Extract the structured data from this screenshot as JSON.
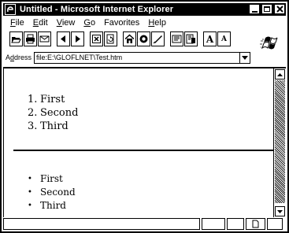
{
  "window": {
    "title": "Untitled - Microsoft Internet Explorer"
  },
  "menubar": {
    "items": [
      {
        "accel": "F",
        "rest": "ile"
      },
      {
        "accel": "E",
        "rest": "dit"
      },
      {
        "accel": "V",
        "rest": "iew"
      },
      {
        "accel": "G",
        "rest": "o"
      },
      {
        "accel": "",
        "rest": "Favorites"
      },
      {
        "accel": "H",
        "rest": "elp"
      }
    ]
  },
  "toolbar": {
    "groups": [
      [
        "open-icon",
        "print-icon",
        "send-icon"
      ],
      [
        "back-icon",
        "forward-icon"
      ],
      [
        "stop-icon",
        "refresh-icon"
      ],
      [
        "home-icon",
        "search-icon",
        "favorites-icon"
      ],
      [
        "read-mail-icon",
        "edit-icon"
      ],
      [
        "larger-font-icon",
        "smaller-font-icon"
      ]
    ],
    "font_larger_label": "A",
    "font_smaller_label": "A"
  },
  "address": {
    "label_accel": "d",
    "label_pre": "A",
    "label_post": "dress",
    "value": "file:E:\\GLOFLNET\\Test.htm"
  },
  "content": {
    "ordered_list": [
      {
        "marker": "1.",
        "text": "First"
      },
      {
        "marker": "2.",
        "text": "Second"
      },
      {
        "marker": "3.",
        "text": "Third"
      }
    ],
    "unordered_list": [
      {
        "marker": "•",
        "text": "First"
      },
      {
        "marker": "•",
        "text": "Second"
      },
      {
        "marker": "•",
        "text": "Third"
      }
    ]
  },
  "statusbar": {
    "main_text": "",
    "zone_icon": "page-icon"
  }
}
